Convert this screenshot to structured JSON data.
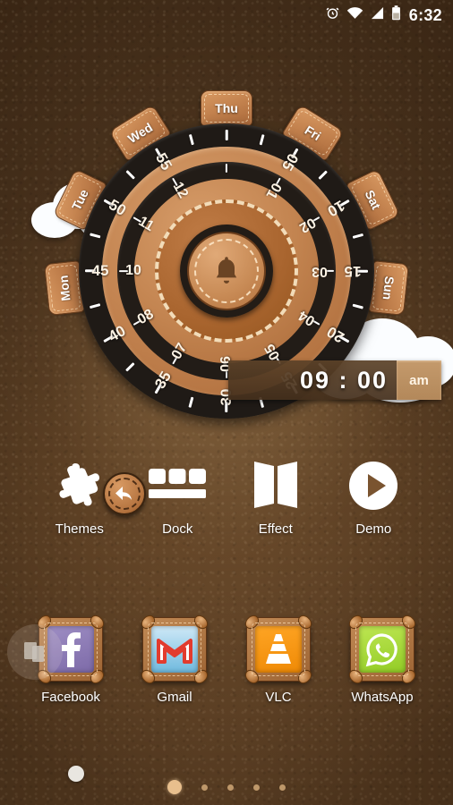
{
  "status_bar": {
    "icons": [
      "alarm-clock-icon",
      "wifi-icon",
      "signal-icon",
      "battery-icon"
    ],
    "time": "6:32"
  },
  "clock_widget": {
    "day_tabs": [
      "Mon",
      "Tue",
      "Wed",
      "Thu",
      "Fri",
      "Sat",
      "Sun"
    ],
    "minute_labels": [
      "05",
      "10",
      "15",
      "20",
      "25",
      "30",
      "35",
      "40",
      "45",
      "50",
      "55"
    ],
    "hour_labels": [
      "01",
      "02",
      "03",
      "04",
      "05",
      "06",
      "07",
      "08",
      "10",
      "11",
      "12"
    ],
    "center_icon": "bell-icon",
    "time_display": "09 : 00",
    "hour_value": "09",
    "minute_value": "00",
    "separator": ":",
    "meridiem": "am",
    "undo_icon": "back-arrow-icon",
    "colors": {
      "leather_light": "#d49a67",
      "leather_dark": "#a96837",
      "ring_dark": "#1f1a16",
      "label_text": "#fdf3e4",
      "time_bar": "#5c4228",
      "ampm_badge": "#c49a6c"
    }
  },
  "shortcuts": [
    {
      "label": "Themes",
      "icon": "puzzle-piece-icon"
    },
    {
      "label": "Dock",
      "icon": "dock-bars-icon"
    },
    {
      "label": "Effect",
      "icon": "book-fold-icon"
    },
    {
      "label": "Demo",
      "icon": "play-circle-icon"
    }
  ],
  "dock": {
    "multitask_icon": "recent-apps-icon",
    "apps": [
      {
        "label": "Facebook",
        "icon": "facebook-icon",
        "bg": "#8b7bb0",
        "glyph": "f"
      },
      {
        "label": "Gmail",
        "icon": "gmail-icon",
        "bg": "#7ec3e8",
        "glyph": "M"
      },
      {
        "label": "VLC",
        "icon": "vlc-cone-icon",
        "bg": "#f59415",
        "glyph": ""
      },
      {
        "label": "WhatsApp",
        "icon": "whatsapp-icon",
        "bg": "#aada3c",
        "glyph": ""
      }
    ]
  },
  "page_indicator": {
    "total": 5,
    "active_index": 0
  }
}
